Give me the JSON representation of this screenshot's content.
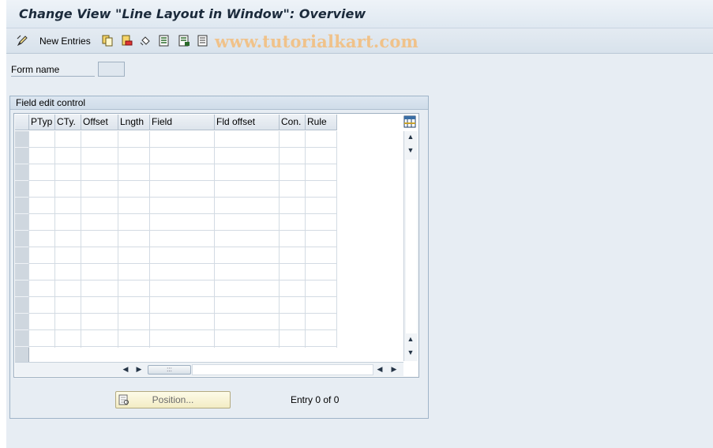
{
  "window": {
    "title": "Change View \"Line Layout in Window\": Overview"
  },
  "toolbar": {
    "new_entries_label": "New Entries",
    "watermark": "www.tutorialkart.com",
    "icons": [
      "change-display-icon",
      "copy-icon",
      "delete-icon",
      "undo-icon",
      "select-all-icon",
      "select-block-icon",
      "deselect-all-icon"
    ]
  },
  "form": {
    "form_name_label": "Form name",
    "form_name_value": ""
  },
  "group": {
    "title": "Field edit control"
  },
  "table": {
    "columns": [
      "PTyp",
      "CTy.",
      "Offset",
      "Lngth",
      "Field",
      "Fld offset",
      "Con.",
      "Rule"
    ],
    "row_count_visible": 14,
    "rows": []
  },
  "footer": {
    "position_label": "Position...",
    "entry_text": "Entry 0 of 0"
  },
  "colors": {
    "background": "#e7edf3",
    "title_text": "#1b2a3b",
    "watermark": "#f0c28a",
    "button_bg": "#f3ecc4"
  }
}
